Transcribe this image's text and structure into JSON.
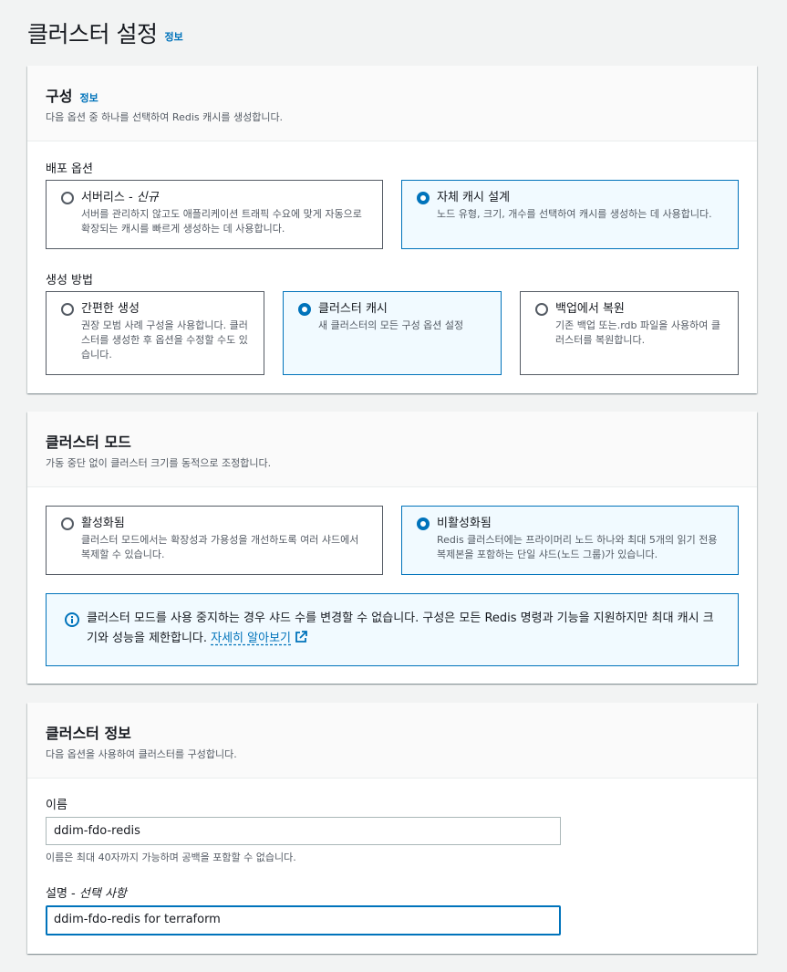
{
  "page": {
    "title": "클러스터 설정",
    "info": "정보"
  },
  "config": {
    "title": "구성",
    "info": "정보",
    "description": "다음 옵션 중 하나를 선택하여 Redis 캐시를 생성합니다.",
    "deploy_label": "배포 옵션",
    "deploy_options": [
      {
        "title": "서버리스 - ",
        "title_em": "신규",
        "desc": "서버를 관리하지 않고도 애플리케이션 트래픽 수요에 맞게 자동으로 확장되는 캐시를 빠르게 생성하는 데 사용합니다.",
        "selected": false
      },
      {
        "title": "자체 캐시 설계",
        "title_em": "",
        "desc": "노드 유형, 크기, 개수를 선택하여 캐시를 생성하는 데 사용합니다.",
        "selected": true
      }
    ],
    "method_label": "생성 방법",
    "method_options": [
      {
        "title": "간편한 생성",
        "desc": "권장 모범 사례 구성을 사용합니다. 클러스터를 생성한 후 옵션을 수정할 수도 있습니다.",
        "selected": false
      },
      {
        "title": "클러스터 캐시",
        "desc": "새 클러스터의 모든 구성 옵션 설정",
        "selected": true
      },
      {
        "title": "백업에서 복원",
        "desc": "기존 백업 또는.rdb 파일을 사용하여 클러스터를 복원합니다.",
        "selected": false
      }
    ]
  },
  "mode": {
    "title": "클러스터 모드",
    "description": "가동 중단 없이 클러스터 크기를 동적으로 조정합니다.",
    "options": [
      {
        "title": "활성화됨",
        "desc": "클러스터 모드에서는 확장성과 가용성을 개선하도록 여러 샤드에서 복제할 수 있습니다.",
        "selected": false
      },
      {
        "title": "비활성화됨",
        "desc": "Redis 클러스터에는 프라이머리 노드 하나와 최대 5개의 읽기 전용 복제본을 포함하는 단일 샤드(노드 그룹)가 있습니다.",
        "selected": true
      }
    ],
    "alert_text": "클러스터 모드를 사용 중지하는 경우 샤드 수를 변경할 수 없습니다. 구성은 모든 Redis 명령과 기능을 지원하지만 최대 캐시 크기와 성능을 제한합니다. ",
    "alert_link": "자세히 알아보기"
  },
  "info_section": {
    "title": "클러스터 정보",
    "description": "다음 옵션을 사용하여 클러스터를 구성합니다.",
    "name_label": "이름",
    "name_value": "ddim-fdo-redis",
    "name_hint": "이름은 최대 40자까지 가능하며 공백을 포함할 수 없습니다.",
    "desc_label": "설명 - ",
    "desc_label_em": "선택 사항",
    "desc_value": "ddim-fdo-redis for terraform"
  },
  "colors": {
    "accent": "#0073bb",
    "selected_bg": "#f1faff",
    "page_bg": "#f2f3f3"
  }
}
